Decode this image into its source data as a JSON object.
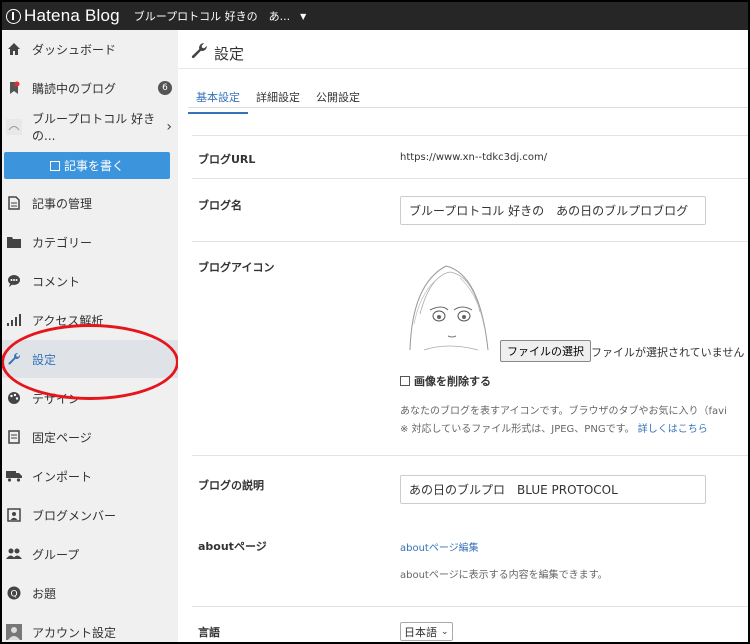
{
  "app": {
    "logo_text": "Hatena Blog",
    "blog_selector": "ブループロトコル 好きの　あ..."
  },
  "sidebar": {
    "items": [
      {
        "label": "ダッシュボード",
        "icon": "home-icon"
      },
      {
        "label": "購読中のブログ",
        "icon": "bookmark-icon",
        "badge": "6"
      },
      {
        "label": "ブループロトコル 好きの...",
        "icon": "blog-avatar-icon"
      },
      {
        "label": "記事の管理",
        "icon": "document-icon"
      },
      {
        "label": "カテゴリー",
        "icon": "folder-icon"
      },
      {
        "label": "コメント",
        "icon": "comment-icon"
      },
      {
        "label": "アクセス解析",
        "icon": "bar-chart-icon"
      },
      {
        "label": "設定",
        "icon": "wrench-icon"
      },
      {
        "label": "デザイン",
        "icon": "palette-icon"
      },
      {
        "label": "固定ページ",
        "icon": "page-icon"
      },
      {
        "label": "インポート",
        "icon": "truck-icon"
      },
      {
        "label": "ブログメンバー",
        "icon": "member-icon"
      },
      {
        "label": "グループ",
        "icon": "group-icon"
      },
      {
        "label": "お題",
        "icon": "theme-icon"
      },
      {
        "label": "アカウント設定",
        "icon": "account-icon"
      }
    ],
    "write_button": "記事を書く"
  },
  "main": {
    "title": "設定",
    "tabs": [
      "基本設定",
      "詳細設定",
      "公開設定"
    ],
    "blog_url": {
      "label": "ブログURL",
      "value": "https://www.xn--tdkc3dj.com/"
    },
    "blog_name": {
      "label": "ブログ名",
      "value": "ブループロトコル 好きの　あの日のブルプロブログ"
    },
    "blog_icon": {
      "label": "ブログアイコン",
      "file_button": "ファイルの選択",
      "file_status": "ファイルが選択されていません",
      "delete_label": "画像を削除する",
      "help1": "あなたのブログを表すアイコンです。ブラウザのタブやお気に入り（favi",
      "help2": "※ 対応しているファイル形式は、JPEG、PNGです。",
      "help_link": "詳しくはこちら"
    },
    "blog_desc": {
      "label": "ブログの説明",
      "value": "あの日のブルプロ　BLUE PROTOCOL"
    },
    "about": {
      "label": "aboutページ",
      "link": "aboutページ編集",
      "help": "aboutページに表示する内容を編集できます。"
    },
    "language": {
      "label": "言語",
      "value": "日本語"
    }
  },
  "colors": {
    "accent": "#3573b9",
    "topbar": "#262626",
    "sidebar_bg": "#f0f0f0",
    "annotation": "#e6141c",
    "write_button": "#3c94dd"
  }
}
